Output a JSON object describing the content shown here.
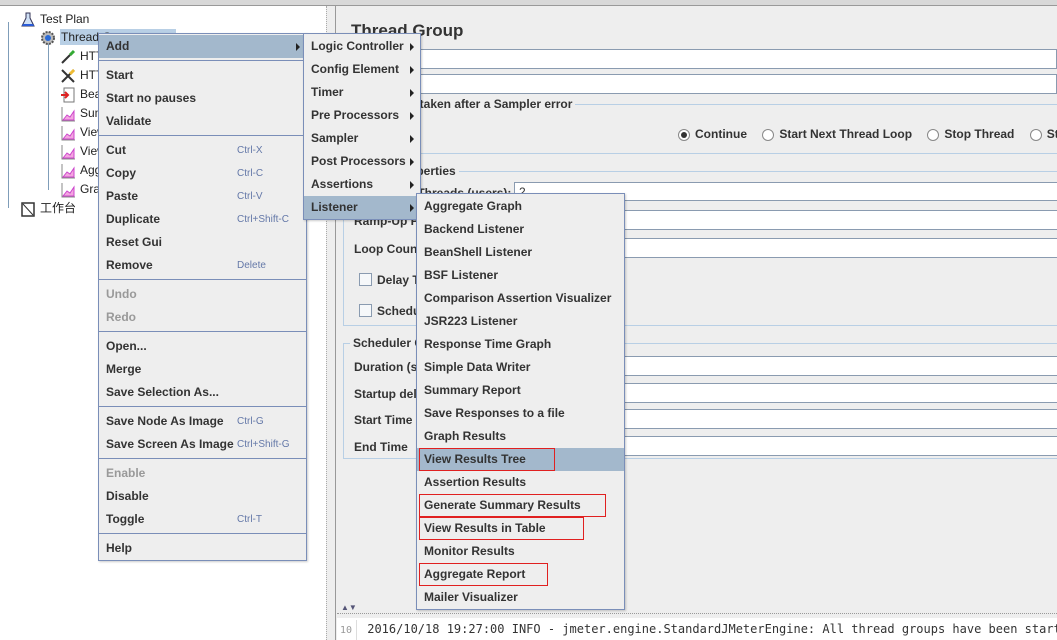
{
  "tree": {
    "nodes": [
      {
        "label": "Test Plan",
        "icon": "flask-icon"
      },
      {
        "label": "Thread Group",
        "icon": "gear-icon",
        "selected": true
      },
      {
        "label": "HTTP Request",
        "icon": "pipette-icon"
      },
      {
        "label": "HTTP Request Defaults",
        "icon": "tools-icon"
      },
      {
        "label": "BeanShell PreProcessor",
        "icon": "document-arrow-icon"
      },
      {
        "label": "Summary Report",
        "icon": "graph-icon"
      },
      {
        "label": "View Results Tree",
        "icon": "graph-icon"
      },
      {
        "label": "View Results in Table",
        "icon": "graph-icon"
      },
      {
        "label": "Aggregate Report",
        "icon": "graph-icon"
      },
      {
        "label": "Graph Results",
        "icon": "graph-icon"
      },
      {
        "label": "工作台",
        "icon": "workbench-icon"
      }
    ]
  },
  "panel": {
    "title": "Thread Group",
    "name_value": "Thread Group",
    "error_group": "Action to be taken after a Sampler error",
    "radios": [
      {
        "label": "Continue",
        "checked": true
      },
      {
        "label": "Start Next Thread Loop"
      },
      {
        "label": "Stop Thread"
      },
      {
        "label": "Stop Test"
      }
    ],
    "thread_props": "Thread Properties",
    "threads_label": "Number of Threads (users):",
    "threads_value": "2",
    "rampup_label": "Ramp-Up Period (in seconds):",
    "loop_label": "Loop Count:",
    "delay_label": "Delay Thread creation until needed",
    "scheduler_label": "Scheduler",
    "sched_group": "Scheduler Configuration",
    "duration_label": "Duration (seconds)",
    "startup_label": "Startup delay (seconds)",
    "start_label": "Start Time",
    "end_label": "End Time"
  },
  "context_menu": {
    "groups": [
      [
        {
          "label": "Add",
          "submenu": true,
          "highlighted": true
        }
      ],
      [
        {
          "label": "Start"
        },
        {
          "label": "Start no pauses"
        },
        {
          "label": "Validate"
        }
      ],
      [
        {
          "label": "Cut",
          "shortcut": "Ctrl-X"
        },
        {
          "label": "Copy",
          "shortcut": "Ctrl-C"
        },
        {
          "label": "Paste",
          "shortcut": "Ctrl-V"
        },
        {
          "label": "Duplicate",
          "shortcut": "Ctrl+Shift-C"
        },
        {
          "label": "Reset Gui"
        },
        {
          "label": "Remove",
          "shortcut": "Delete"
        }
      ],
      [
        {
          "label": "Undo",
          "disabled": true
        },
        {
          "label": "Redo",
          "disabled": true
        }
      ],
      [
        {
          "label": "Open..."
        },
        {
          "label": "Merge"
        },
        {
          "label": "Save Selection As..."
        }
      ],
      [
        {
          "label": "Save Node As Image",
          "shortcut": "Ctrl-G"
        },
        {
          "label": "Save Screen As Image",
          "shortcut": "Ctrl+Shift-G"
        }
      ],
      [
        {
          "label": "Enable",
          "disabled": true
        },
        {
          "label": "Disable"
        },
        {
          "label": "Toggle",
          "shortcut": "Ctrl-T"
        }
      ],
      [
        {
          "label": "Help"
        }
      ]
    ]
  },
  "add_submenu": [
    "Logic Controller",
    "Config Element",
    "Timer",
    "Pre Processors",
    "Sampler",
    "Post Processors",
    "Assertions",
    "Listener"
  ],
  "add_submenu_highlighted": "Listener",
  "listener_submenu": {
    "items": [
      "Aggregate Graph",
      "Backend Listener",
      "BeanShell Listener",
      "BSF Listener",
      "Comparison Assertion Visualizer",
      "JSR223 Listener",
      "Response Time Graph",
      "Simple Data Writer",
      "Summary Report",
      "Save Responses to a file",
      "Graph Results",
      "View Results Tree",
      "Assertion Results",
      "Generate Summary Results",
      "View Results in Table",
      "Monitor Results",
      "Aggregate Report",
      "Mailer Visualizer"
    ],
    "highlighted": "View Results Tree",
    "red_boxed": [
      "View Results Tree",
      "Generate Summary Results",
      "View Results in Table",
      "Aggregate Report"
    ]
  },
  "log": {
    "line_no": "10",
    "text": "2016/10/18 19:27:00 INFO  - jmeter.engine.StandardJMeterEngine: All thread groups have been started"
  },
  "colors": {
    "highlight": "#a3b8cc",
    "menu_border": "#7a8eb8",
    "annotation": "#e02020"
  }
}
